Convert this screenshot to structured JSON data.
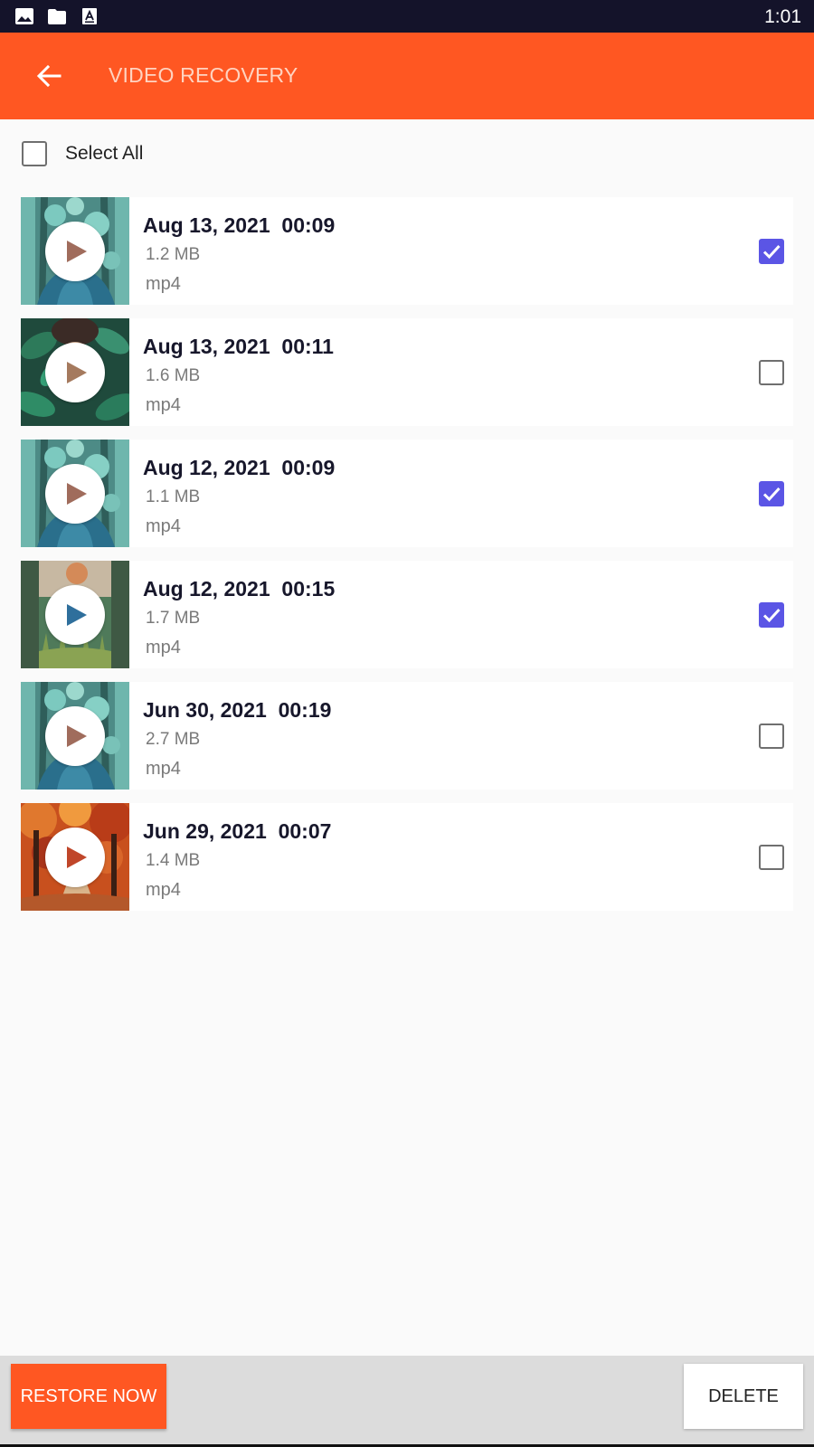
{
  "status_bar": {
    "time": "1:01",
    "icons": [
      "image-icon",
      "folder-icon",
      "font-icon"
    ]
  },
  "app_bar": {
    "title": "VIDEO RECOVERY",
    "back_icon": "arrow-left-icon"
  },
  "select_all": {
    "label": "Select All",
    "checked": false
  },
  "videos": [
    {
      "date": "Aug 13, 2021  00:09",
      "size": "1.2 MB",
      "ext": "mp4",
      "checked": true,
      "thumb": "teal-forest"
    },
    {
      "date": "Aug 13, 2021  00:11",
      "size": "1.6 MB",
      "ext": "mp4",
      "checked": false,
      "thumb": "green-leaves"
    },
    {
      "date": "Aug 12, 2021  00:09",
      "size": "1.1 MB",
      "ext": "mp4",
      "checked": true,
      "thumb": "teal-forest"
    },
    {
      "date": "Aug 12, 2021  00:15",
      "size": "1.7 MB",
      "ext": "mp4",
      "checked": true,
      "thumb": "grass-sunset"
    },
    {
      "date": "Jun 30, 2021  00:19",
      "size": "2.7 MB",
      "ext": "mp4",
      "checked": false,
      "thumb": "teal-forest"
    },
    {
      "date": "Jun 29, 2021  00:07",
      "size": "1.4 MB",
      "ext": "mp4",
      "checked": false,
      "thumb": "autumn-trees"
    }
  ],
  "actions": {
    "restore_label": "RESTORE NOW",
    "delete_label": "DELETE"
  },
  "colors": {
    "accent": "#ff5722",
    "checkbox_checked": "#5b55e5",
    "status_bar": "#14132a"
  }
}
